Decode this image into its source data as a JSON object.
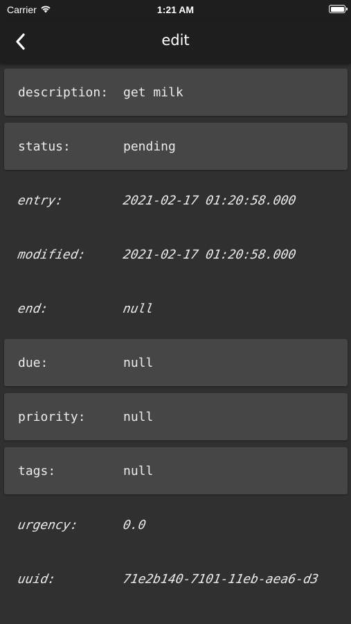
{
  "status_bar": {
    "carrier": "Carrier",
    "time": "1:21 AM"
  },
  "nav": {
    "title": "edit",
    "back_icon": "chevron-left-icon"
  },
  "fields": [
    {
      "label": "description:",
      "value": "get milk",
      "editable": true
    },
    {
      "label": "status:",
      "value": "pending",
      "editable": true
    },
    {
      "label": "entry:",
      "value": "2021-02-17 01:20:58.000",
      "editable": false
    },
    {
      "label": "modified:",
      "value": "2021-02-17 01:20:58.000",
      "editable": false
    },
    {
      "label": "end:",
      "value": "null",
      "editable": false
    },
    {
      "label": "due:",
      "value": "null",
      "editable": true
    },
    {
      "label": "priority:",
      "value": "null",
      "editable": true
    },
    {
      "label": "tags:",
      "value": "null",
      "editable": true
    },
    {
      "label": "urgency:",
      "value": "0.0",
      "editable": false
    },
    {
      "label": "uuid:",
      "value": "71e2b140-7101-11eb-aea6-d3",
      "editable": false
    }
  ],
  "colors": {
    "background": "#303030",
    "bar": "#1e1e1e",
    "card": "#464646",
    "text": "#ececec"
  }
}
